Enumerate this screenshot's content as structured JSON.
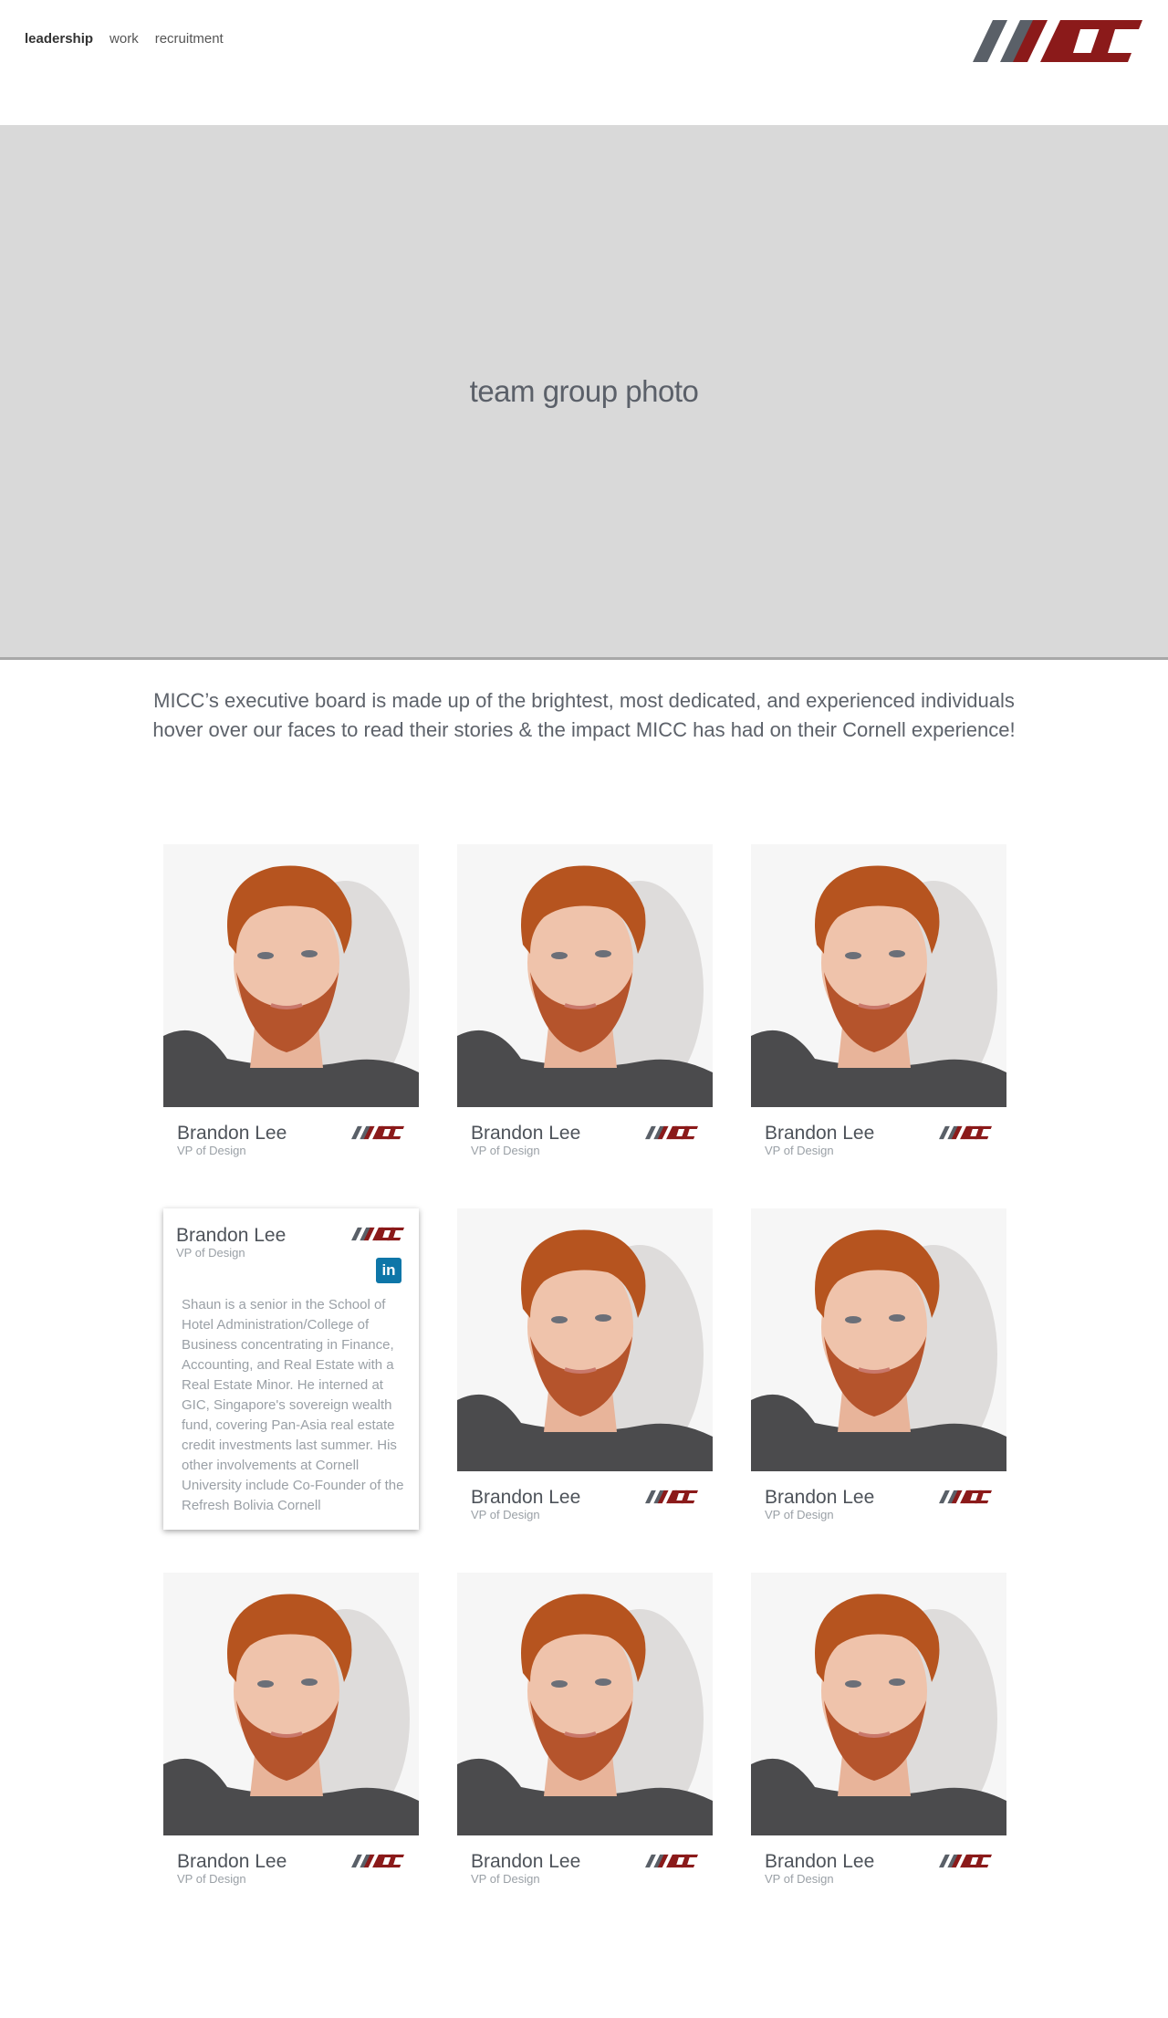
{
  "nav": {
    "links": [
      {
        "label": "leadership",
        "active": true
      },
      {
        "label": "work",
        "active": false
      },
      {
        "label": "recruitment",
        "active": false
      }
    ],
    "logo_text": "MICC"
  },
  "hero": {
    "label": "team group photo"
  },
  "intro": {
    "line1": "MICC’s executive board is made up of the brightest, most dedicated, and experienced individuals",
    "line2": "hover over our faces to read their stories & the impact MICC has had on their Cornell experience!"
  },
  "colors": {
    "brand_red": "#8b1a1a",
    "brand_gray": "#555b63",
    "linkedin": "#0e76a8"
  },
  "members": [
    {
      "name": "Brandon Lee",
      "role": "VP of Design"
    },
    {
      "name": "Brandon Lee",
      "role": "VP of Design"
    },
    {
      "name": "Brandon Lee",
      "role": "VP of Design"
    },
    {
      "name": "Brandon Lee",
      "role": "VP of Design",
      "expanded": true,
      "bio": "Shaun is a senior in the School of Hotel Administration/College of Business concentrating in Finance, Accounting, and Real Estate with a Real Estate Minor. He interned at GIC, Singapore's sovereign wealth fund, covering Pan-Asia real estate credit investments last summer. His other involvements at Cornell University include Co-Founder of the Refresh Bolivia Cornell",
      "linkedin_label": "in"
    },
    {
      "name": "Brandon Lee",
      "role": "VP of Design"
    },
    {
      "name": "Brandon Lee",
      "role": "VP of Design"
    },
    {
      "name": "Brandon Lee",
      "role": "VP of Design"
    },
    {
      "name": "Brandon Lee",
      "role": "VP of Design"
    },
    {
      "name": "Brandon Lee",
      "role": "VP of Design"
    }
  ]
}
